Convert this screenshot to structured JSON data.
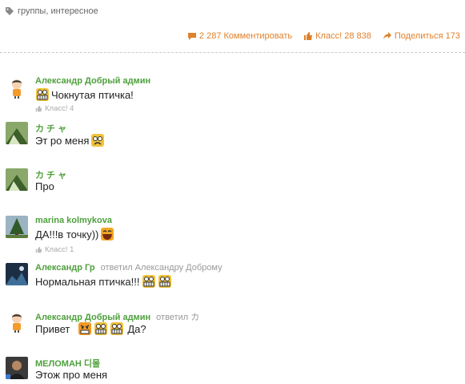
{
  "tags": {
    "label": "группы, интересное"
  },
  "actions": {
    "comments": "2 287 Комментировать",
    "klass": "Класс! 28 838",
    "share": "Поделиться 173"
  },
  "colors": {
    "accent": "#e0802a",
    "author": "#4ea03c",
    "meta": "#999999"
  },
  "comments": [
    {
      "author": "Александр Добрый админ",
      "replied": "",
      "text_before": "",
      "text": "Чокнутая птичка!",
      "klass": "Класс! 4",
      "avatar": "cartoon-boy"
    },
    {
      "author": "カ チ ャ",
      "replied": "",
      "text": "Эт ро меня",
      "klass": "",
      "avatar": "photo-green"
    },
    {
      "author": "カ チ ャ",
      "replied": "",
      "text": "Про",
      "klass": "",
      "avatar": "photo-green"
    },
    {
      "author": "marina kolmykova",
      "replied": "",
      "text": "ДА!!!в точку))",
      "klass": "Класс! 1",
      "avatar": "photo-tree"
    },
    {
      "author": "Александр Гр",
      "replied": "ответил Александру Доброму",
      "text": "Нормальная птичка!!!",
      "klass": "",
      "avatar": "photo-dark"
    },
    {
      "author": "Александр Добрый админ",
      "replied": "ответил カ",
      "text": "Привет",
      "text_after": "Да?",
      "klass": "",
      "avatar": "cartoon-boy"
    },
    {
      "author": "МЕЛОМАН 디몰",
      "replied": "",
      "text": "Этож про меня",
      "klass": "",
      "avatar": "photo-man"
    }
  ]
}
